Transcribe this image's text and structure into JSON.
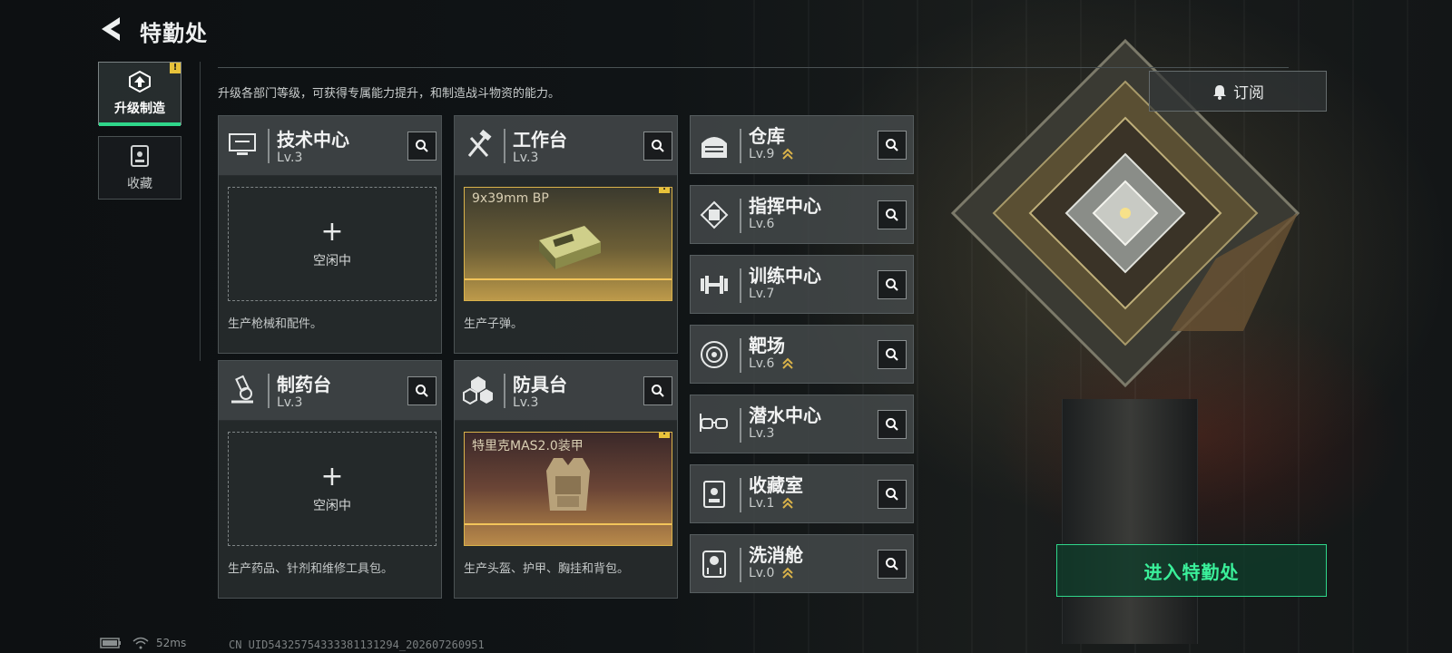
{
  "header": {
    "title": "特勤处"
  },
  "tabs": [
    {
      "label": "升级制造",
      "active": true,
      "notice": "!"
    },
    {
      "label": "收藏",
      "active": false
    }
  ],
  "description": "升级各部门等级，可获得专属能力提升，和制造战斗物资的能力。",
  "cards": [
    {
      "name": "技术中心",
      "level": "Lv.3",
      "state": "idle",
      "idle_label": "空闲中",
      "footer": "生产枪械和配件。",
      "icon": "monitor-icon"
    },
    {
      "name": "工作台",
      "level": "Lv.3",
      "state": "producing",
      "product": "9x39mm BP",
      "notice": "!",
      "footer": "生产子弹。",
      "icon": "hammer-wrench-icon"
    },
    {
      "name": "制药台",
      "level": "Lv.3",
      "state": "idle",
      "idle_label": "空闲中",
      "footer": "生产药品、针剂和维修工具包。",
      "icon": "microscope-icon"
    },
    {
      "name": "防具台",
      "level": "Lv.3",
      "state": "producing",
      "product": "特里克MAS2.0装甲",
      "notice": "!",
      "footer": "生产头盔、护甲、胸挂和背包。",
      "icon": "blocks-icon"
    }
  ],
  "facilities": [
    {
      "name": "仓库",
      "level": "Lv.9",
      "upgradable": true,
      "icon": "warehouse-icon"
    },
    {
      "name": "指挥中心",
      "level": "Lv.6",
      "upgradable": false,
      "icon": "chip-icon"
    },
    {
      "name": "训练中心",
      "level": "Lv.7",
      "upgradable": false,
      "icon": "dumbbell-icon"
    },
    {
      "name": "靶场",
      "level": "Lv.6",
      "upgradable": true,
      "icon": "target-icon"
    },
    {
      "name": "潜水中心",
      "level": "Lv.3",
      "upgradable": false,
      "icon": "diving-mask-icon"
    },
    {
      "name": "收藏室",
      "level": "Lv.1",
      "upgradable": true,
      "icon": "collection-icon"
    },
    {
      "name": "洗消舱",
      "level": "Lv.0",
      "upgradable": true,
      "icon": "decon-icon"
    }
  ],
  "subscribe_label": "订阅",
  "enter_label": "进入特勤处",
  "status": {
    "ping": "52ms",
    "uid": "CN UID5432575433338113129­4_202607260951"
  },
  "colors": {
    "accent": "#2fd68a",
    "notice": "#e8c23a",
    "upgrade": "#d9b24a"
  }
}
